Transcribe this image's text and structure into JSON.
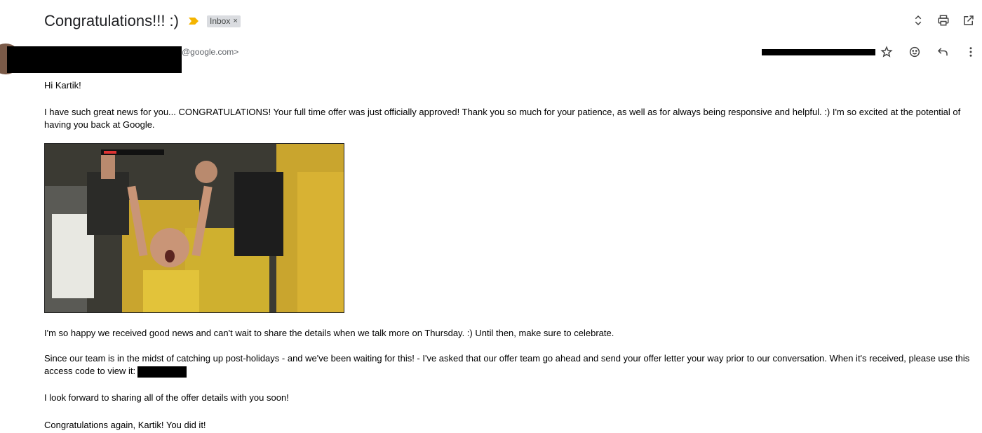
{
  "email": {
    "subject": "Congratulations!!! :)",
    "label": "Inbox",
    "label_remove": "×",
    "sender_email_suffix": "@google.com>",
    "paragraphs": {
      "greeting": "Hi Kartik!",
      "p1": "I have such great news for you... CONGRATULATIONS! Your full time offer was just officially approved! Thank you so much for your patience, as well as for always being responsive and helpful. :) I'm so excited at the potential of having you back at Google.",
      "p2": "I'm so happy we received good news and can't wait to share the details when we talk more on Thursday. :) Until then, make sure to celebrate.",
      "p3": "Since our team is in the midst of catching up post-holidays - and we've been waiting for this! - I've asked that our offer team go ahead and send your offer letter your way prior to our conversation. When it's received, please use this access code to view it:",
      "p4": "I look forward to sharing all of the offer details with you soon!",
      "p5": "Congratulations again, Kartik! You did it!"
    }
  },
  "icons": {
    "importance": "importance-marker-icon",
    "expand": "expand-collapse-icon",
    "print": "print-icon",
    "open_new": "open-in-new-window-icon",
    "star": "star-icon",
    "emoji": "emoji-reaction-icon",
    "reply": "reply-icon",
    "more": "more-vertical-icon"
  },
  "colors": {
    "importance": "#f4b400",
    "label_bg": "#dadce0"
  }
}
